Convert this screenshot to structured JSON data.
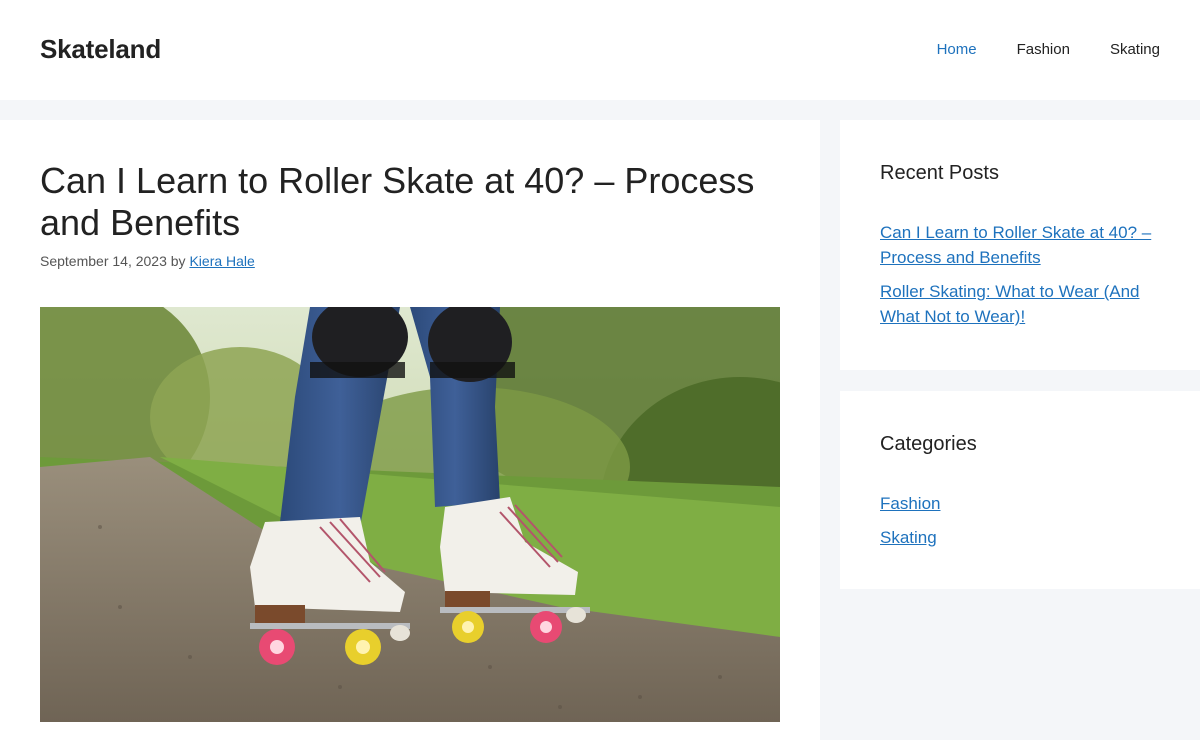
{
  "site": {
    "title": "Skateland"
  },
  "nav": {
    "items": [
      {
        "label": "Home"
      },
      {
        "label": "Fashion"
      },
      {
        "label": "Skating"
      }
    ]
  },
  "post": {
    "title": "Can I Learn to Roller Skate at 40? – Process and Benefits",
    "date": "September 14, 2023",
    "by": "by",
    "author": "Kiera Hale"
  },
  "sidebar": {
    "recent": {
      "title": "Recent Posts",
      "items": [
        {
          "label": "Can I Learn to Roller Skate at 40? – Process and Benefits"
        },
        {
          "label": "Roller Skating: What to Wear (And What Not to Wear)!"
        }
      ]
    },
    "categories": {
      "title": "Categories",
      "items": [
        {
          "label": "Fashion"
        },
        {
          "label": "Skating"
        }
      ]
    }
  },
  "colors": {
    "link": "#1e72bd",
    "page_bg": "#f4f6f9",
    "text": "#222222"
  }
}
